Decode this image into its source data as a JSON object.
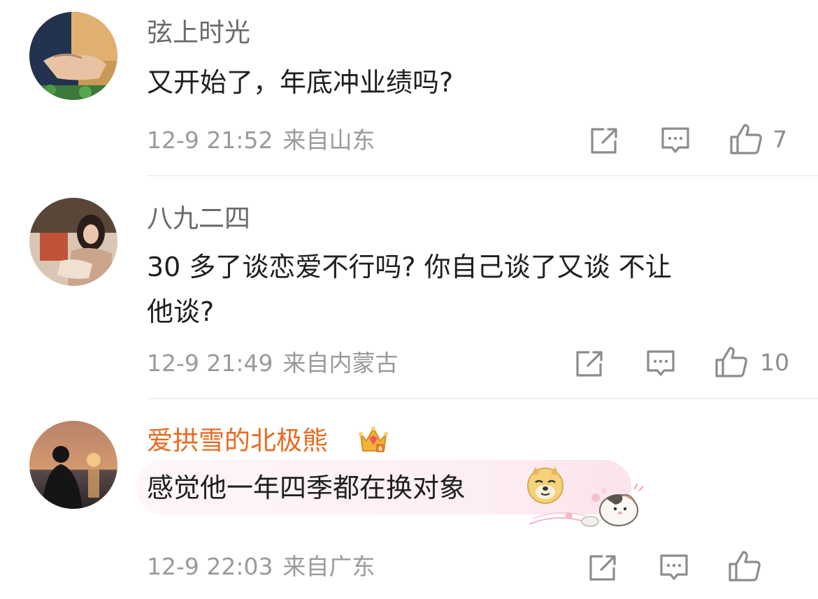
{
  "comments": [
    {
      "username": "弦上时光",
      "text": "又开始了，年底冲业绩吗?",
      "date": "12-9 21:52",
      "location": "来自山东",
      "likes": "7"
    },
    {
      "username": "八九二四",
      "text_line1": "30 多了谈恋爱不行吗? 你自己谈了又谈 不让",
      "text_line2": "他谈?",
      "date": "12-9 21:49",
      "location": "来自内蒙古",
      "likes": "10"
    },
    {
      "username": "爱拱雪的北极熊",
      "text": "感觉他一年四季都在换对象",
      "date": "12-9 22:03",
      "location": "来自广东"
    }
  ],
  "icons": {
    "share": "share-icon",
    "reply": "comment-icon",
    "like": "thumb-up-icon",
    "vip_badge": "crown-icon",
    "emoji": "doge-emoji"
  },
  "colors": {
    "vip_username": "#ea6a1f",
    "meta_text": "#9a9a9a",
    "icon_gray": "#8c8c8c"
  }
}
